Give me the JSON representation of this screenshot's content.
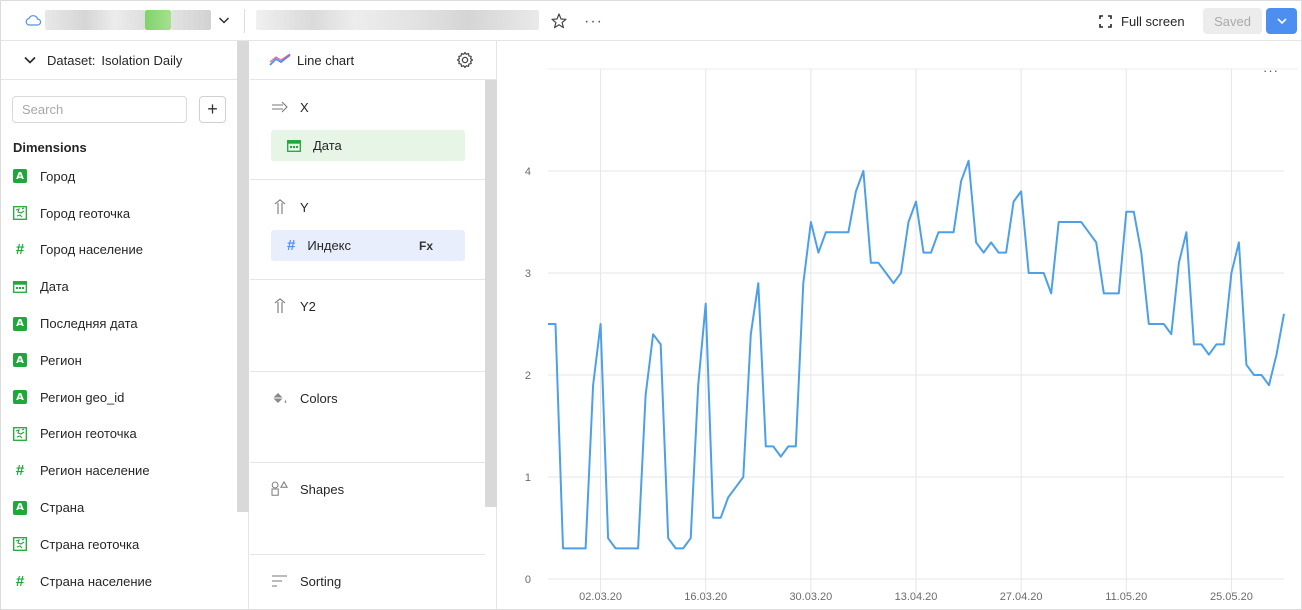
{
  "topbar": {
    "fullscreen_label": "Full screen",
    "saved_label": "Saved",
    "icons": [
      "cloud-icon",
      "chevron-down-icon",
      "star-icon",
      "more-icon",
      "fullscreen-icon"
    ],
    "accent": "#4d8ff0"
  },
  "dataset": {
    "label": "Dataset:",
    "name": "Isolation Daily",
    "search_placeholder": "Search",
    "dimensions_title": "Dimensions",
    "fields": [
      {
        "name": "Город",
        "type": "string"
      },
      {
        "name": "Город геоточка",
        "type": "geo"
      },
      {
        "name": "Город население",
        "type": "number"
      },
      {
        "name": "Дата",
        "type": "date"
      },
      {
        "name": "Последняя дата",
        "type": "string"
      },
      {
        "name": "Регион",
        "type": "string"
      },
      {
        "name": "Регион geo_id",
        "type": "string"
      },
      {
        "name": "Регион геоточка",
        "type": "geo"
      },
      {
        "name": "Регион население",
        "type": "number"
      },
      {
        "name": "Страна",
        "type": "string"
      },
      {
        "name": "Страна геоточка",
        "type": "geo"
      },
      {
        "name": "Страна население",
        "type": "number"
      }
    ]
  },
  "wizard": {
    "visualization": "Line chart",
    "sections": {
      "x": {
        "title": "X",
        "field": "Дата"
      },
      "y": {
        "title": "Y",
        "field": "Индекс",
        "badge": "Fx"
      },
      "y2": {
        "title": "Y2"
      },
      "colors": {
        "title": "Colors"
      },
      "shapes": {
        "title": "Shapes"
      },
      "sorting": {
        "title": "Sorting"
      }
    }
  },
  "chart_data": {
    "type": "line",
    "ylim": [
      0,
      4.2
    ],
    "yticks": [
      0,
      1,
      2,
      3,
      4
    ],
    "xlabels": [
      "02.03.20",
      "16.03.20",
      "30.03.20",
      "13.04.20",
      "27.04.20",
      "11.05.20",
      "25.05.20"
    ],
    "grid": true,
    "color": "#4da0e8",
    "x_start": "2020-02-24",
    "series": [
      {
        "values": [
          2.5,
          2.5,
          0.3,
          0.3,
          0.3,
          0.3,
          1.9,
          2.5,
          0.4,
          0.3,
          0.3,
          0.3,
          0.3,
          1.8,
          2.4,
          2.3,
          0.4,
          0.3,
          0.3,
          0.4,
          1.9,
          2.7,
          0.6,
          0.6,
          0.8,
          0.9,
          1.0,
          2.4,
          2.9,
          1.3,
          1.3,
          1.2,
          1.3,
          1.3,
          2.9,
          3.5,
          3.2,
          3.4,
          3.4,
          3.4,
          3.4,
          3.8,
          4.0,
          3.1,
          3.1,
          3.0,
          2.9,
          3.0,
          3.5,
          3.7,
          3.2,
          3.2,
          3.4,
          3.4,
          3.4,
          3.9,
          4.1,
          3.3,
          3.2,
          3.3,
          3.2,
          3.2,
          3.7,
          3.8,
          3.0,
          3.0,
          3.0,
          2.8,
          3.5,
          3.5,
          3.5,
          3.5,
          3.4,
          3.3,
          2.8,
          2.8,
          2.8,
          3.6,
          3.6,
          3.2,
          2.5,
          2.5,
          2.5,
          2.4,
          3.1,
          3.4,
          2.3,
          2.3,
          2.2,
          2.3,
          2.3,
          3.0,
          3.3,
          2.1,
          2.0,
          2.0,
          1.9,
          2.2,
          2.6
        ]
      }
    ]
  }
}
